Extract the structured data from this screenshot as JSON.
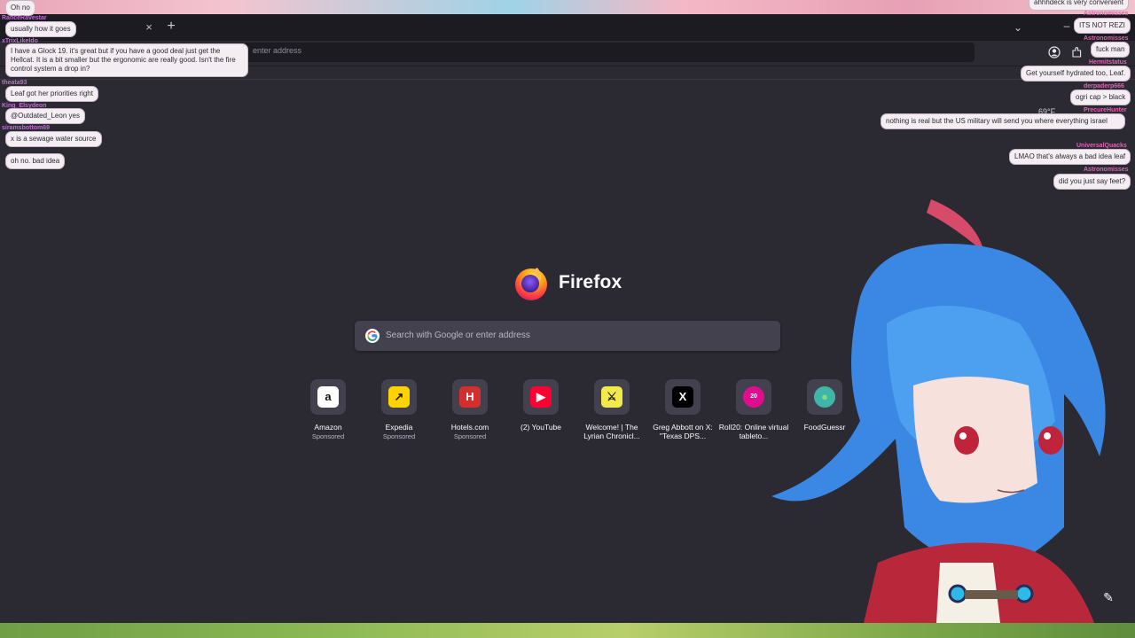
{
  "browser": {
    "tab_close_glyph": "×",
    "new_tab_glyph": "+",
    "tab_list_glyph": "⌄",
    "minimize_glyph": "–",
    "url_placeholder": "enter address"
  },
  "newtab": {
    "brand": "Firefox",
    "search_placeholder": "Search with Google or enter address",
    "edit_glyph": "✎"
  },
  "tiles": [
    {
      "title": "Amazon",
      "sub": "Sponsored",
      "glyph": "a",
      "bg": "#ffffff",
      "fg": "#111111"
    },
    {
      "title": "Expedia",
      "sub": "Sponsored",
      "glyph": "↗",
      "bg": "#ffd200",
      "fg": "#1b1b1b"
    },
    {
      "title": "Hotels.com",
      "sub": "Sponsored",
      "glyph": "H",
      "bg": "#d32f2f",
      "fg": "#ffffff"
    },
    {
      "title": "(2) YouTube",
      "sub": "",
      "glyph": "▶",
      "bg": "#ff0033",
      "fg": "#ffffff"
    },
    {
      "title": "Welcome! | The Lyrian Chronicl...",
      "sub": "",
      "glyph": "⚔",
      "bg": "#f1ea4a",
      "fg": "#222222"
    },
    {
      "title": "Greg Abbott on X: \"Texas DPS...",
      "sub": "",
      "glyph": "X",
      "bg": "#000000",
      "fg": "#ffffff"
    },
    {
      "title": "Roll20: Online virtual tableto...",
      "sub": "",
      "glyph": "20",
      "bg": "#e10d8f",
      "fg": "#ffffff"
    },
    {
      "title": "FoodGuessr",
      "sub": "",
      "glyph": "●",
      "bg": "#3fb6a8",
      "fg": "#7be07b"
    }
  ],
  "chat_left": [
    {
      "user": "",
      "text": "Oh no"
    },
    {
      "user": "RanceRavestar",
      "text": "usually how it goes"
    },
    {
      "user": "xTrixLikeIdo",
      "text": "I have a Glock 19. it's great but if you have a good deal just get the Hellcat. It is a bit smaller but the ergonomic are really good. Isn't the fire control system a drop in?"
    },
    {
      "user": "theata93",
      "text": "Leaf got her priorities right"
    },
    {
      "user": "King_Elsydeon",
      "text": "@Outdated_Leon yes"
    },
    {
      "user": "siramsbottom69",
      "text": "x is a sewage water source"
    },
    {
      "user": "",
      "text": "oh no. bad idea"
    }
  ],
  "chat_right": [
    {
      "user": "",
      "text": "ahhhdeck is very convenient"
    },
    {
      "user": "Astronomisses",
      "text": "ITS NOT REZI"
    },
    {
      "user": "Astronomisses",
      "text": "fuck man"
    },
    {
      "user": "Hermitstatus",
      "text": "Get yourself hydrated too, Leaf."
    },
    {
      "user": "derpaderp666",
      "text": "ogri cap > black"
    },
    {
      "user": "PrecureHunter",
      "text": "nothing is real but the US military will send you where everything israel"
    },
    {
      "user": "UniversalQuacks",
      "text": "LMAO that's always a bad idea leaf"
    },
    {
      "user": "Astronomisses",
      "text": "did you just say feet?"
    }
  ],
  "weather_partial": "69°F",
  "colors": {
    "accent": "#e063b3",
    "bg": "#2b2a33",
    "search": "#42414d"
  }
}
